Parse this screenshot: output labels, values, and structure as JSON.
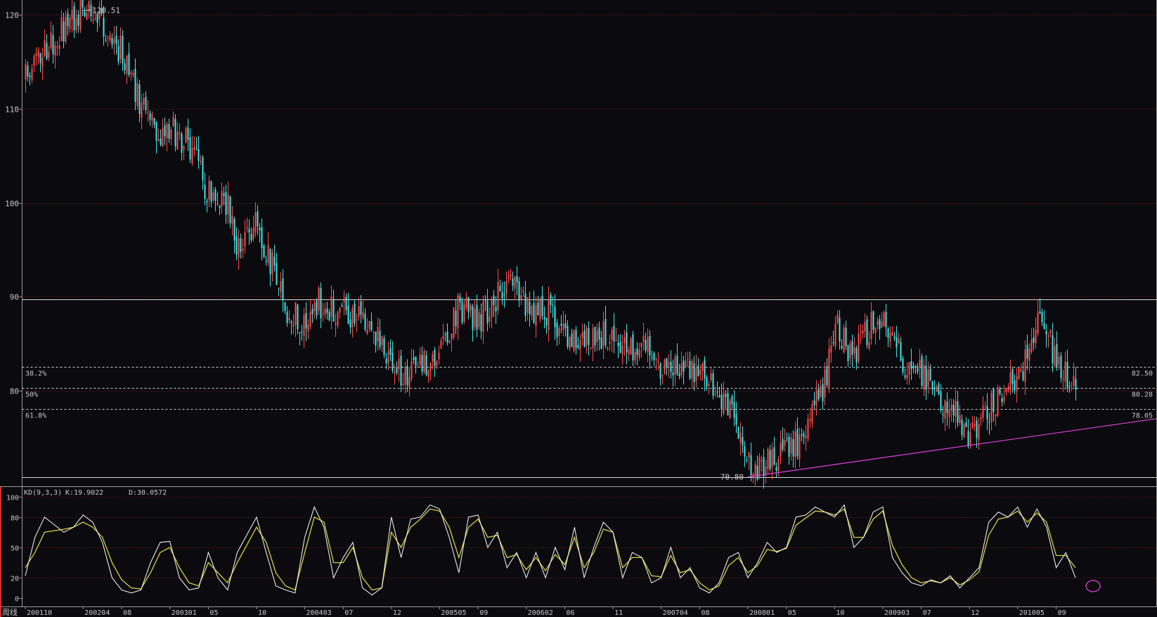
{
  "chart_data": [
    {
      "type": "candlestick",
      "period_label": "周线",
      "y_ticks": [
        120,
        110,
        100,
        90,
        80
      ],
      "ylim": [
        70.4,
        121.6
      ],
      "x_tick_labels": [
        "200110",
        "200204",
        "08",
        "200301",
        "05",
        "10",
        "200403",
        "07",
        "12",
        "200505",
        "09",
        "200602",
        "06",
        "11",
        "200704",
        "08",
        "200801",
        "05",
        "10",
        "200903",
        "07",
        "12",
        "201005",
        "09"
      ],
      "colors": {
        "up": "#ff4a4a",
        "down": "#3ee7e7",
        "background": "#0b0a0e",
        "grid": "#7a2020",
        "trendline": "#e040e0"
      },
      "annotations": {
        "high_label": "120.51",
        "high_value": 120.51,
        "low_label": "70.80",
        "low_value": 70.8
      },
      "fib_levels": [
        {
          "pct": "38.2%",
          "price": "82.50",
          "value": 82.5
        },
        {
          "pct": "50%",
          "price": "80.28",
          "value": 80.28
        },
        {
          "pct": "61.8%",
          "price": "78.05",
          "value": 78.05
        }
      ],
      "horizontal_lines": [
        89.7,
        70.8
      ],
      "trendline": {
        "from": {
          "x": "200801",
          "y": 70.8
        },
        "to": {
          "x": "201011",
          "y": 77.0
        }
      },
      "price_path": [
        [
          "200110",
          113.5
        ],
        [
          "200112",
          116.5
        ],
        [
          "200202",
          118.5
        ],
        [
          "200204",
          120.51
        ],
        [
          "200206",
          119
        ],
        [
          "200208",
          116
        ],
        [
          "200210",
          110
        ],
        [
          "200212",
          107.5
        ],
        [
          "200301",
          108
        ],
        [
          "200303",
          106
        ],
        [
          "200305",
          101
        ],
        [
          "200307",
          100
        ],
        [
          "200308",
          95
        ],
        [
          "200310",
          98
        ],
        [
          "200312",
          92
        ],
        [
          "200401",
          88
        ],
        [
          "200403",
          87.5
        ],
        [
          "200404",
          89.5
        ],
        [
          "200407",
          88.5
        ],
        [
          "200410",
          87
        ],
        [
          "200412",
          82.5
        ],
        [
          "200502",
          81.5
        ],
        [
          "200505",
          84.5
        ],
        [
          "200507",
          89
        ],
        [
          "200509",
          87.5
        ],
        [
          "200512",
          91.5
        ],
        [
          "200602",
          89
        ],
        [
          "200604",
          88.5
        ],
        [
          "200606",
          86
        ],
        [
          "200608",
          85.5
        ],
        [
          "200611",
          86
        ],
        [
          "200701",
          84
        ],
        [
          "200703",
          84.5
        ],
        [
          "200704",
          82.5
        ],
        [
          "200706",
          82
        ],
        [
          "200708",
          82.5
        ],
        [
          "200710",
          79.5
        ],
        [
          "200712",
          76
        ],
        [
          "200801",
          72.5
        ],
        [
          "200802",
          71.5
        ],
        [
          "200805",
          73.5
        ],
        [
          "200807",
          75.5
        ],
        [
          "200809",
          81
        ],
        [
          "200810",
          87
        ],
        [
          "200812",
          83.5
        ],
        [
          "200901",
          86
        ],
        [
          "200903",
          88.5
        ],
        [
          "200905",
          83
        ],
        [
          "200907",
          81.5
        ],
        [
          "200909",
          79
        ],
        [
          "200911",
          77
        ],
        [
          "200912",
          75
        ],
        [
          "201001",
          76.5
        ],
        [
          "201003",
          79.5
        ],
        [
          "201005",
          81
        ],
        [
          "201006",
          84
        ],
        [
          "201007",
          87.5
        ],
        [
          "201008",
          86
        ],
        [
          "201009",
          83
        ],
        [
          "201010",
          82
        ],
        [
          "201011",
          79.5
        ]
      ]
    },
    {
      "type": "line",
      "indicator_name": "KD(9,3,3)",
      "k_label": "K:19.9022",
      "d_label": "D:30.0572",
      "y_ticks": [
        100,
        80,
        50,
        20,
        0
      ],
      "ylim": [
        0,
        100
      ],
      "series": [
        {
          "name": "K",
          "color": "#e8e8e8"
        },
        {
          "name": "D",
          "color": "#d8d040"
        }
      ],
      "k_path": [
        [
          "200110",
          22
        ],
        [
          "200111",
          60
        ],
        [
          "200112",
          80
        ],
        [
          "200202",
          65
        ],
        [
          "200203",
          70
        ],
        [
          "200204",
          82
        ],
        [
          "200205",
          75
        ],
        [
          "200206",
          55
        ],
        [
          "200207",
          20
        ],
        [
          "200208",
          8
        ],
        [
          "200209",
          5
        ],
        [
          "200210",
          8
        ],
        [
          "200211",
          35
        ],
        [
          "200212",
          55
        ],
        [
          "200301",
          56
        ],
        [
          "200302",
          20
        ],
        [
          "200303",
          8
        ],
        [
          "200304",
          10
        ],
        [
          "200305",
          45
        ],
        [
          "200306",
          20
        ],
        [
          "200307",
          8
        ],
        [
          "200308",
          45
        ],
        [
          "200310",
          80
        ],
        [
          "200311",
          45
        ],
        [
          "200312",
          12
        ],
        [
          "200401",
          8
        ],
        [
          "200402",
          5
        ],
        [
          "200403",
          60
        ],
        [
          "200404",
          90
        ],
        [
          "200405",
          70
        ],
        [
          "200406",
          20
        ],
        [
          "200407",
          40
        ],
        [
          "200408",
          55
        ],
        [
          "200409",
          10
        ],
        [
          "200410",
          3
        ],
        [
          "200411",
          10
        ],
        [
          "200412",
          80
        ],
        [
          "200501",
          40
        ],
        [
          "200502",
          78
        ],
        [
          "200503",
          80
        ],
        [
          "200504",
          92
        ],
        [
          "200505",
          88
        ],
        [
          "200506",
          60
        ],
        [
          "200507",
          25
        ],
        [
          "200508",
          80
        ],
        [
          "200509",
          82
        ],
        [
          "200510",
          50
        ],
        [
          "200511",
          65
        ],
        [
          "200512",
          30
        ],
        [
          "200601",
          45
        ],
        [
          "200602",
          20
        ],
        [
          "200603",
          45
        ],
        [
          "200604",
          20
        ],
        [
          "200605",
          50
        ],
        [
          "200606",
          28
        ],
        [
          "200607",
          70
        ],
        [
          "200608",
          20
        ],
        [
          "200609",
          50
        ],
        [
          "200610",
          75
        ],
        [
          "200611",
          65
        ],
        [
          "200612",
          20
        ],
        [
          "200701",
          45
        ],
        [
          "200702",
          40
        ],
        [
          "200703",
          15
        ],
        [
          "200704",
          20
        ],
        [
          "200705",
          50
        ],
        [
          "200706",
          20
        ],
        [
          "200707",
          30
        ],
        [
          "200708",
          10
        ],
        [
          "200709",
          5
        ],
        [
          "200710",
          15
        ],
        [
          "200711",
          40
        ],
        [
          "200712",
          45
        ],
        [
          "200801",
          20
        ],
        [
          "200802",
          35
        ],
        [
          "200803",
          55
        ],
        [
          "200804",
          45
        ],
        [
          "200805",
          50
        ],
        [
          "200806",
          80
        ],
        [
          "200807",
          82
        ],
        [
          "200808",
          90
        ],
        [
          "200809",
          85
        ],
        [
          "200810",
          80
        ],
        [
          "200811",
          92
        ],
        [
          "200812",
          50
        ],
        [
          "200901",
          60
        ],
        [
          "200902",
          85
        ],
        [
          "200903",
          90
        ],
        [
          "200904",
          40
        ],
        [
          "200905",
          25
        ],
        [
          "200906",
          15
        ],
        [
          "200907",
          12
        ],
        [
          "200908",
          18
        ],
        [
          "200909",
          15
        ],
        [
          "200910",
          22
        ],
        [
          "200911",
          10
        ],
        [
          "200912",
          20
        ],
        [
          "201001",
          30
        ],
        [
          "201002",
          75
        ],
        [
          "201003",
          85
        ],
        [
          "201004",
          80
        ],
        [
          "201005",
          90
        ],
        [
          "201006",
          70
        ],
        [
          "201007",
          88
        ],
        [
          "201008",
          70
        ],
        [
          "201009",
          30
        ],
        [
          "201010",
          45
        ],
        [
          "201011",
          20
        ]
      ],
      "d_path": [
        [
          "200110",
          30
        ],
        [
          "200111",
          45
        ],
        [
          "200112",
          65
        ],
        [
          "200202",
          68
        ],
        [
          "200203",
          70
        ],
        [
          "200204",
          75
        ],
        [
          "200205",
          70
        ],
        [
          "200206",
          60
        ],
        [
          "200207",
          35
        ],
        [
          "200208",
          18
        ],
        [
          "200209",
          10
        ],
        [
          "200210",
          9
        ],
        [
          "200211",
          25
        ],
        [
          "200212",
          45
        ],
        [
          "200301",
          50
        ],
        [
          "200302",
          30
        ],
        [
          "200303",
          15
        ],
        [
          "200304",
          12
        ],
        [
          "200305",
          35
        ],
        [
          "200306",
          25
        ],
        [
          "200307",
          15
        ],
        [
          "200308",
          35
        ],
        [
          "200310",
          70
        ],
        [
          "200311",
          55
        ],
        [
          "200312",
          25
        ],
        [
          "200401",
          12
        ],
        [
          "200402",
          8
        ],
        [
          "200403",
          45
        ],
        [
          "200404",
          80
        ],
        [
          "200405",
          75
        ],
        [
          "200406",
          35
        ],
        [
          "200407",
          35
        ],
        [
          "200408",
          50
        ],
        [
          "200409",
          20
        ],
        [
          "200410",
          8
        ],
        [
          "200411",
          10
        ],
        [
          "200412",
          65
        ],
        [
          "200501",
          50
        ],
        [
          "200502",
          70
        ],
        [
          "200503",
          78
        ],
        [
          "200504",
          88
        ],
        [
          "200505",
          86
        ],
        [
          "200506",
          70
        ],
        [
          "200507",
          40
        ],
        [
          "200508",
          70
        ],
        [
          "200509",
          78
        ],
        [
          "200510",
          60
        ],
        [
          "200511",
          62
        ],
        [
          "200512",
          40
        ],
        [
          "200601",
          43
        ],
        [
          "200602",
          28
        ],
        [
          "200603",
          40
        ],
        [
          "200604",
          27
        ],
        [
          "200605",
          43
        ],
        [
          "200606",
          33
        ],
        [
          "200607",
          60
        ],
        [
          "200608",
          30
        ],
        [
          "200609",
          45
        ],
        [
          "200610",
          68
        ],
        [
          "200611",
          65
        ],
        [
          "200612",
          30
        ],
        [
          "200701",
          40
        ],
        [
          "200702",
          40
        ],
        [
          "200703",
          22
        ],
        [
          "200704",
          21
        ],
        [
          "200705",
          42
        ],
        [
          "200706",
          25
        ],
        [
          "200707",
          28
        ],
        [
          "200708",
          15
        ],
        [
          "200709",
          8
        ],
        [
          "200710",
          12
        ],
        [
          "200711",
          32
        ],
        [
          "200712",
          40
        ],
        [
          "200801",
          25
        ],
        [
          "200802",
          32
        ],
        [
          "200803",
          48
        ],
        [
          "200804",
          46
        ],
        [
          "200805",
          49
        ],
        [
          "200806",
          72
        ],
        [
          "200807",
          79
        ],
        [
          "200808",
          86
        ],
        [
          "200809",
          85
        ],
        [
          "200810",
          82
        ],
        [
          "200811",
          88
        ],
        [
          "200812",
          60
        ],
        [
          "200901",
          60
        ],
        [
          "200902",
          78
        ],
        [
          "200903",
          86
        ],
        [
          "200904",
          52
        ],
        [
          "200905",
          33
        ],
        [
          "200906",
          20
        ],
        [
          "200907",
          15
        ],
        [
          "200908",
          17
        ],
        [
          "200909",
          15
        ],
        [
          "200910",
          20
        ],
        [
          "200911",
          13
        ],
        [
          "200912",
          18
        ],
        [
          "201001",
          26
        ],
        [
          "201002",
          62
        ],
        [
          "201003",
          78
        ],
        [
          "201004",
          80
        ],
        [
          "201005",
          86
        ],
        [
          "201006",
          75
        ],
        [
          "201007",
          84
        ],
        [
          "201008",
          75
        ],
        [
          "201009",
          42
        ],
        [
          "201010",
          42
        ],
        [
          "201011",
          30
        ]
      ]
    }
  ]
}
